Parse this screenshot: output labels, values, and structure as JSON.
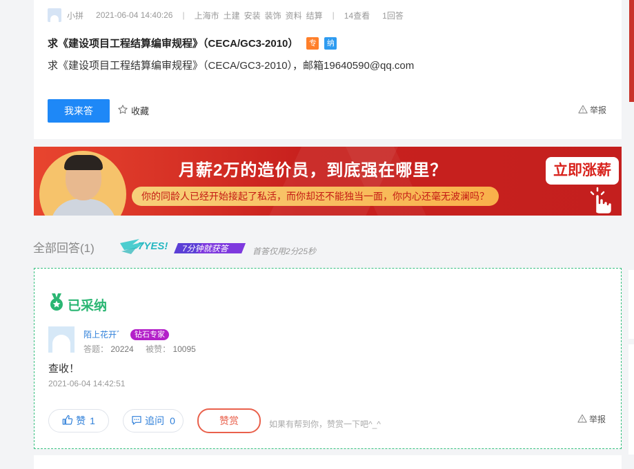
{
  "question": {
    "author": "小拼",
    "datetime": "2021-06-04 14:40:26",
    "location": "上海市",
    "categories": [
      "土建",
      "安装",
      "装饰",
      "资料",
      "结算"
    ],
    "views": "14查看",
    "answers_count": "1回答",
    "title": "求《建设项目工程结算编审规程》（CECA/GC3-2010）",
    "tag_zhuan": "专",
    "tag_na": "纳",
    "body": "求《建设项目工程结算编审规程》（CECA/GC3-2010），邮箱19640590@qq.com",
    "answer_button": "我来答",
    "favorite": "收藏",
    "report": "举报"
  },
  "banner": {
    "title": "月薪2万的造价员，到底强在哪里？",
    "subtitle": "你的同龄人已经开始接起了私活，而你却还不能独当一面，你内心还毫无波澜吗？",
    "cta": "立即涨薪"
  },
  "answers_header": {
    "label": "全部回答(1)",
    "yes_text": "7YES!",
    "yes_sub": "7分钟就获答",
    "first_answer": "首答仅用2分25秒"
  },
  "answer": {
    "adopted_label": "已采纳",
    "user_name": "陌上花开゛",
    "user_badge": "钻石专家",
    "answers_label": "答题：",
    "answers_num": "20224",
    "likes_label": "被赞：",
    "likes_num": "10095",
    "text": "查收！",
    "time": "2021-06-04 14:42:51",
    "like_label": "赞",
    "like_count": "1",
    "ask_label": "追问",
    "ask_count": "0",
    "reward_label": "赞赏",
    "hint": "如果有帮到你，赞赏一下吧^_^",
    "report": "举报"
  },
  "colors": {
    "primary": "#1e88f7",
    "adopted_green": "#2bb673",
    "banner_red": "#c8211e",
    "reward_red": "#e9604b",
    "badge_purple": "#b320c9"
  }
}
